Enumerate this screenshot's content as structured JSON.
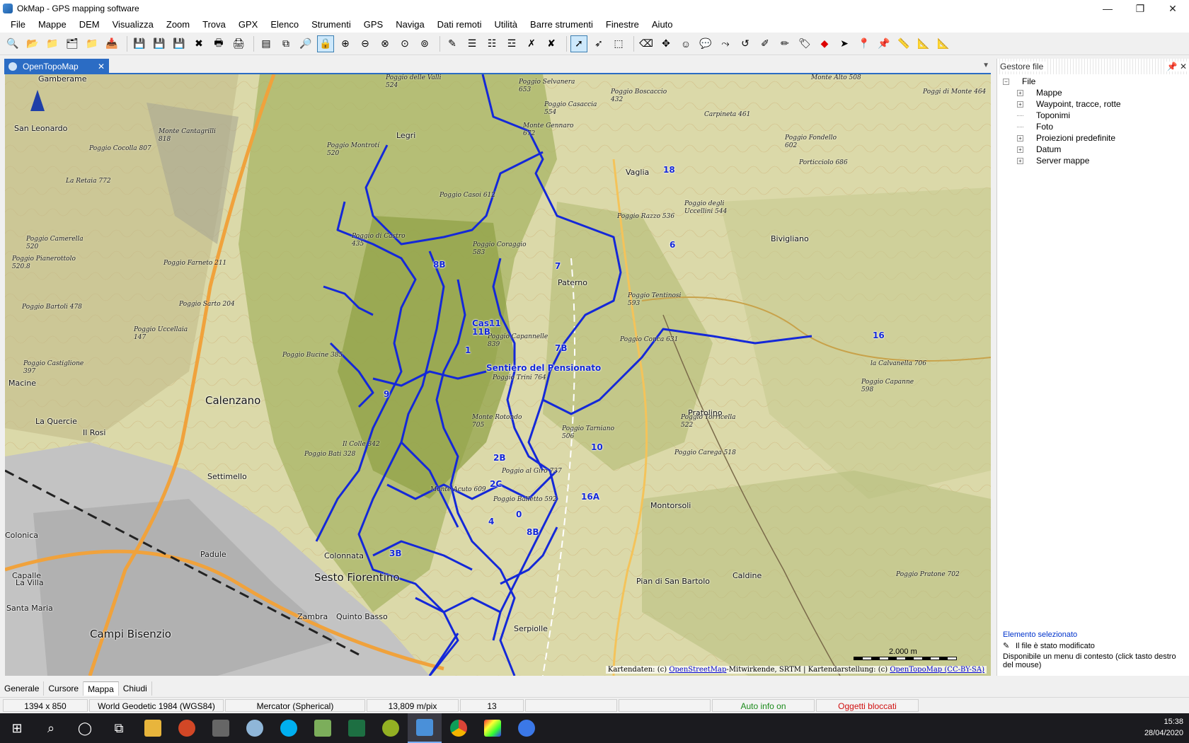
{
  "window": {
    "title": "OkMap - GPS mapping software"
  },
  "menu": [
    "File",
    "Mappe",
    "DEM",
    "Visualizza",
    "Zoom",
    "Trova",
    "GPX",
    "Elenco",
    "Strumenti",
    "GPS",
    "Naviga",
    "Dati remoti",
    "Utilità",
    "Barre strumenti",
    "Finestre",
    "Aiuto"
  ],
  "doc_tab": {
    "label": "OpenTopoMap"
  },
  "map": {
    "place_labels": [
      {
        "name": "Calenzano",
        "size": "big"
      },
      {
        "name": "Sesto Fiorentino",
        "size": "big"
      },
      {
        "name": "Campi Bisenzio",
        "size": "big"
      },
      {
        "name": "Vaglia",
        "size": "mid"
      },
      {
        "name": "Legri",
        "size": "mid"
      },
      {
        "name": "Paterno",
        "size": "mid"
      },
      {
        "name": "Pratolino",
        "size": "mid"
      },
      {
        "name": "Montorsoli",
        "size": "mid"
      },
      {
        "name": "Bivigliano",
        "size": "mid"
      },
      {
        "name": "Caldine",
        "size": "mid"
      },
      {
        "name": "Settimello",
        "size": "mid"
      },
      {
        "name": "Colonnata",
        "size": "mid"
      },
      {
        "name": "Padule",
        "size": "mid"
      },
      {
        "name": "Quinto Basso",
        "size": "mid"
      },
      {
        "name": "Serpiolle",
        "size": "mid"
      },
      {
        "name": "Zambra",
        "size": "mid"
      },
      {
        "name": "La Quercie",
        "size": "mid"
      },
      {
        "name": "Capalle",
        "size": "mid"
      },
      {
        "name": "Colonica",
        "size": "mid"
      },
      {
        "name": "Il Rosi",
        "size": "mid"
      },
      {
        "name": "Macine",
        "size": "mid"
      },
      {
        "name": "San Leonardo",
        "size": "mid"
      },
      {
        "name": "Gamberame",
        "size": "mid"
      },
      {
        "name": "La Villa",
        "size": "mid"
      },
      {
        "name": "Santa Maria",
        "size": "mid"
      },
      {
        "name": "Pian di San Bartolo",
        "size": "mid"
      }
    ],
    "peaks": [
      "Poggio delle Valli 524",
      "Poggio Selvanera 653",
      "Poggio Boscaccio 432",
      "Poggio Casaccia 554",
      "Monte Gennaro 672",
      "Carpineta 461",
      "Monte Alto 508",
      "Poggi di Monte 464",
      "Monte Cantagrilli 818",
      "Poggio Cocolla 807",
      "Poggio Montrotí 520",
      "Poggio Fondello 602",
      "Porticciolo 686",
      "La Retaia 772",
      "Poggio Casoi 612",
      "Poggio degli Uccellini 544",
      "Poggio Razzo 536",
      "Poggio Camerella 520",
      "Poggio di Castro 435",
      "Poggio Coraggio 583",
      "Poggio Pianerottolo 520.8",
      "Poggio Farneto 211",
      "Poggio Sarto 204",
      "Poggio Tentinosi 593",
      "Poggio Bartoli 478",
      "Poggio Uccellaia 147",
      "Poggio Capannelle 839",
      "Poggio Conca 631",
      "Poggio Castiglione 397",
      "Poggio Bucine 385",
      "Poggio Trini 764",
      "la Calvanella 706",
      "Poggio Capanne 598",
      "Monte Rotondo 705",
      "Poggio Torricella 522",
      "Il Colle 342",
      "Poggio Bati 328",
      "Poggio Tarniano 506",
      "Poggio Carega 518",
      "Poggio al Giro 737",
      "Monte Acuto 609",
      "Poggio Balletto 592",
      "Poggio Pratone 702"
    ],
    "trail_labels": [
      "8B",
      "7",
      "6",
      "16",
      "11",
      "11B",
      "1",
      "7B",
      "Sentiero del Pensionato",
      "9",
      "2B",
      "2C",
      "16A",
      "4",
      "8B",
      "3B",
      "0",
      "18",
      "Cas.",
      "10"
    ],
    "attribution": {
      "prefix": "Kartendaten: (c) ",
      "osm": "OpenStreetMap",
      "mid": "-Mitwirkende, SRTM | Kartendarstellung: (c) ",
      "otm": "OpenTopoMap (CC-BY-SA)"
    },
    "scale_label": "2.000 m"
  },
  "side_panel": {
    "title": "Gestore file",
    "root": "File",
    "items": [
      {
        "label": "Mappe",
        "expandable": true
      },
      {
        "label": "Waypoint, tracce, rotte",
        "expandable": true
      },
      {
        "label": "Toponimi",
        "expandable": false
      },
      {
        "label": "Foto",
        "expandable": false
      },
      {
        "label": "Proiezioni predefinite",
        "expandable": true
      },
      {
        "label": "Datum",
        "expandable": true
      },
      {
        "label": "Server mappe",
        "expandable": true
      }
    ],
    "selected_title": "Elemento selezionato",
    "modified": "Il file è stato modificato",
    "context_hint": "Disponibile un menu di contesto (click tasto destro del mouse)"
  },
  "bottom_tabs": [
    "Generale",
    "Cursore",
    "Mappa",
    "Chiudi"
  ],
  "active_bottom_tab": "Mappa",
  "status": {
    "size": "1394 x 850",
    "datum": "World Geodetic 1984 (WGS84)",
    "projection": "Mercator (Spherical)",
    "resolution": "13,809 m/pix",
    "zoom": "13",
    "auto_info": "Auto info on",
    "locked": "Oggetti bloccati"
  },
  "status_colors": {
    "auto_info": "#1a8a1a",
    "locked": "#d01010"
  },
  "colors": {
    "trail": "#1428d8",
    "tab_blue": "#2b6cc4",
    "road_orange": "#f0a23c",
    "urban": "#b9b9b9"
  },
  "taskbar": {
    "apps": [
      "windows-start",
      "search",
      "cortana",
      "task-view",
      "file-explorer",
      "powerpoint",
      "calculator",
      "fox-app",
      "skype",
      "notepad",
      "excel",
      "qgis",
      "okmap",
      "chrome",
      "color-app",
      "edge"
    ],
    "time": "15:38",
    "date": "28/04/2020"
  }
}
